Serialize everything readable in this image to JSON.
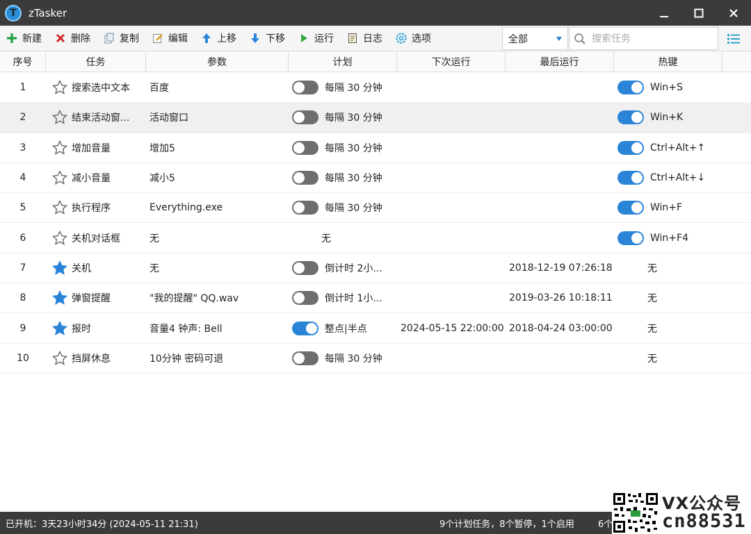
{
  "window": {
    "title": "zTasker",
    "logo_letter": "T"
  },
  "toolbar": {
    "buttons": [
      {
        "label": "新建",
        "icon": "plus-icon"
      },
      {
        "label": "删除",
        "icon": "x-icon"
      },
      {
        "label": "复制",
        "icon": "copy-icon"
      },
      {
        "label": "编辑",
        "icon": "edit-icon"
      },
      {
        "label": "上移",
        "icon": "arrow-up-icon"
      },
      {
        "label": "下移",
        "icon": "arrow-down-icon"
      },
      {
        "label": "运行",
        "icon": "play-icon"
      },
      {
        "label": "日志",
        "icon": "log-icon"
      },
      {
        "label": "选项",
        "icon": "gear-icon"
      }
    ],
    "filter_value": "全部",
    "search_placeholder": "搜索任务"
  },
  "table": {
    "columns": [
      "序号",
      "任务",
      "参数",
      "计划",
      "下次运行",
      "最后运行",
      "热键"
    ],
    "rows": [
      {
        "idx": "1",
        "starred": false,
        "task": "搜索选中文本",
        "param": "百度",
        "plan_toggle": "off",
        "plan": "每隔 30 分钟",
        "next": "",
        "last": "",
        "hot_toggle": "on",
        "hotkey": "Win+S"
      },
      {
        "idx": "2",
        "starred": false,
        "task": "结束活动窗...",
        "param": "活动窗口",
        "plan_toggle": "off",
        "plan": "每隔 30 分钟",
        "next": "",
        "last": "",
        "hot_toggle": "on",
        "hotkey": "Win+K"
      },
      {
        "idx": "3",
        "starred": false,
        "task": "增加音量",
        "param": "增加5",
        "plan_toggle": "off",
        "plan": "每隔 30 分钟",
        "next": "",
        "last": "",
        "hot_toggle": "on",
        "hotkey": "Ctrl+Alt+↑"
      },
      {
        "idx": "4",
        "starred": false,
        "task": "减小音量",
        "param": "减小5",
        "plan_toggle": "off",
        "plan": "每隔 30 分钟",
        "next": "",
        "last": "",
        "hot_toggle": "on",
        "hotkey": "Ctrl+Alt+↓"
      },
      {
        "idx": "5",
        "starred": false,
        "task": "执行程序",
        "param": "Everything.exe",
        "plan_toggle": "off",
        "plan": "每隔 30 分钟",
        "next": "",
        "last": "",
        "hot_toggle": "on",
        "hotkey": "Win+F"
      },
      {
        "idx": "6",
        "starred": false,
        "task": "关机对话框",
        "param": "无",
        "plan_toggle": "none",
        "plan": "无",
        "next": "",
        "last": "",
        "hot_toggle": "on",
        "hotkey": "Win+F4"
      },
      {
        "idx": "7",
        "starred": true,
        "task": "关机",
        "param": "无",
        "plan_toggle": "off",
        "plan": "倒计时 2小...",
        "next": "",
        "last": "2018-12-19 07:26:18",
        "hot_toggle": "none",
        "hotkey": "无"
      },
      {
        "idx": "8",
        "starred": true,
        "task": "弹窗提醒",
        "param": "\"我的提醒\" QQ.wav",
        "plan_toggle": "off",
        "plan": "倒计时 1小...",
        "next": "",
        "last": "2019-03-26 10:18:11",
        "hot_toggle": "none",
        "hotkey": "无"
      },
      {
        "idx": "9",
        "starred": true,
        "task": "报时",
        "param": "音量4 钟声: Bell",
        "plan_toggle": "on",
        "plan": "整点|半点",
        "next": "2024-05-15 22:00:00",
        "last": "2018-04-24 03:00:00",
        "hot_toggle": "none",
        "hotkey": "无"
      },
      {
        "idx": "10",
        "starred": false,
        "task": "挡屏休息",
        "param": "10分钟 密码可退",
        "plan_toggle": "off",
        "plan": "每隔 30 分钟",
        "next": "",
        "last": "",
        "hot_toggle": "none",
        "hotkey": "无"
      }
    ]
  },
  "status": {
    "uptime": "已开机：3天23小时34分 (2024-05-11 21:31)",
    "summary": "9个计划任务，8个暂停，1个启用",
    "tail": "6个"
  },
  "watermark": {
    "line1": "VX公众号",
    "line2": "cn88531"
  },
  "colors": {
    "accent": "#2a84d8",
    "titlebar": "#3b3b3b",
    "star_filled": "#2a84d8",
    "toggle_off": "#6e6e6e"
  }
}
